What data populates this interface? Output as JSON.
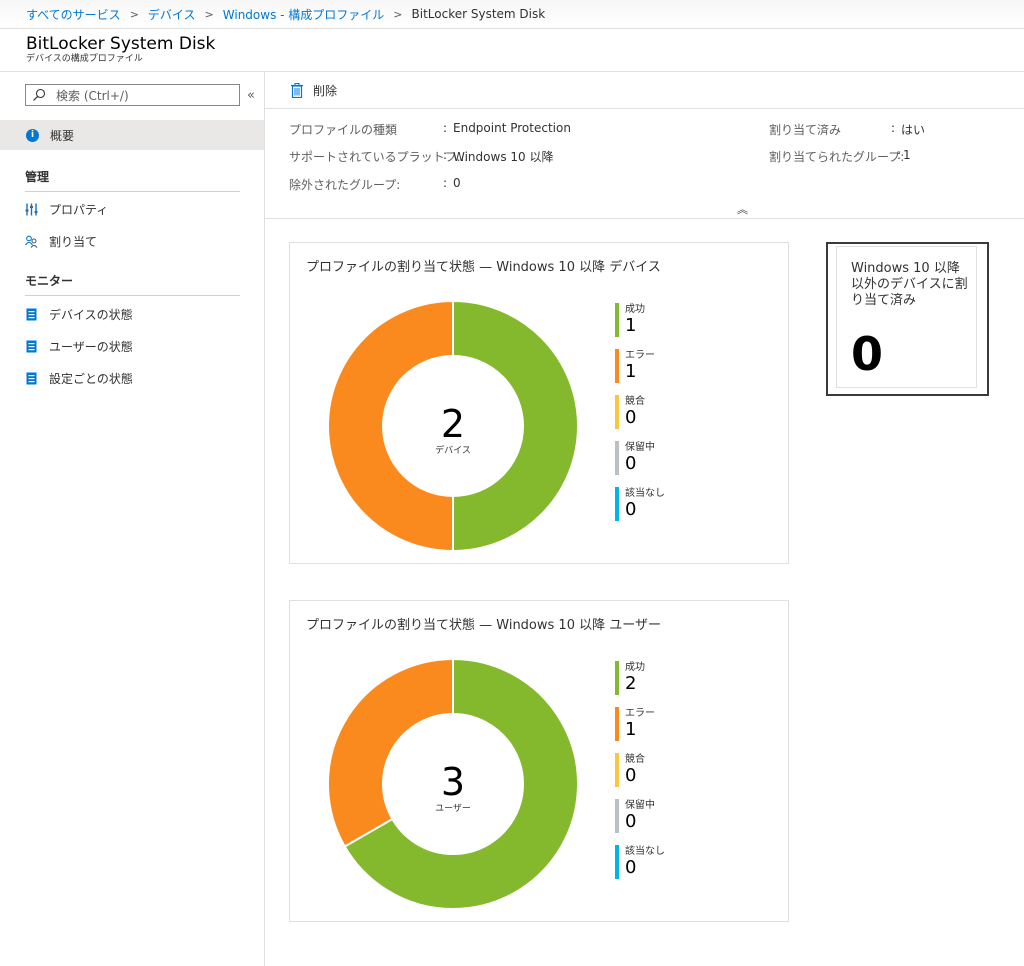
{
  "breadcrumb": {
    "items": [
      "すべてのサービス",
      "デバイス",
      "Windows - 構成プロファイル"
    ],
    "current": "BitLocker System Disk"
  },
  "header": {
    "title": "BitLocker System Disk",
    "subtitle": "デバイスの構成プロファイル"
  },
  "sidebar": {
    "search_placeholder": "検索 (Ctrl+/)",
    "collapse_glyph": "«",
    "overview": "概要",
    "manage_heading": "管理",
    "manage_items": [
      "プロパティ",
      "割り当て"
    ],
    "monitor_heading": "モニター",
    "monitor_items": [
      "デバイスの状態",
      "ユーザーの状態",
      "設定ごとの状態"
    ]
  },
  "toolbar": {
    "delete_label": "削除"
  },
  "essentials": {
    "rows": [
      {
        "label": "プロファイルの種類",
        "value": "Endpoint Protection"
      },
      {
        "label": "サポートされているプラットフ...",
        "value": "Windows 10 以降"
      },
      {
        "label": "除外されたグループ:",
        "value": "0"
      }
    ],
    "right_rows": [
      {
        "label": "割り当て済み",
        "value": "はい"
      },
      {
        "label": "割り当てられたグループ:",
        "value": "1"
      }
    ],
    "separator": ":",
    "collapse_glyph": "︽"
  },
  "colors": {
    "success": "#84b82d",
    "error": "#fb8a1e",
    "conflict": "#f9c63c",
    "pending": "#b9c0c6",
    "not_applicable": "#00b4e6",
    "accent": "#0078d4"
  },
  "chart_data": [
    {
      "type": "pie",
      "title": "プロファイルの割り当て状態 — Windows 10 以降 デバイス",
      "total": 2,
      "unit": "デバイス",
      "categories": [
        "成功",
        "エラー",
        "競合",
        "保留中",
        "該当なし"
      ],
      "values": [
        1,
        1,
        0,
        0,
        0
      ]
    },
    {
      "type": "pie",
      "title": "プロファイルの割り当て状態 — Windows 10 以降 ユーザー",
      "total": 3,
      "unit": "ユーザー",
      "categories": [
        "成功",
        "エラー",
        "競合",
        "保留中",
        "該当なし"
      ],
      "values": [
        2,
        1,
        0,
        0,
        0
      ]
    }
  ],
  "tile": {
    "label": "Windows 10 以降以外のデバイスに割り当て済み",
    "value": "0"
  },
  "icons": {
    "search": "search-icon",
    "info": "info-icon",
    "properties": "properties-icon",
    "assignments": "people-icon",
    "status": "status-icon",
    "delete": "trash-icon"
  }
}
